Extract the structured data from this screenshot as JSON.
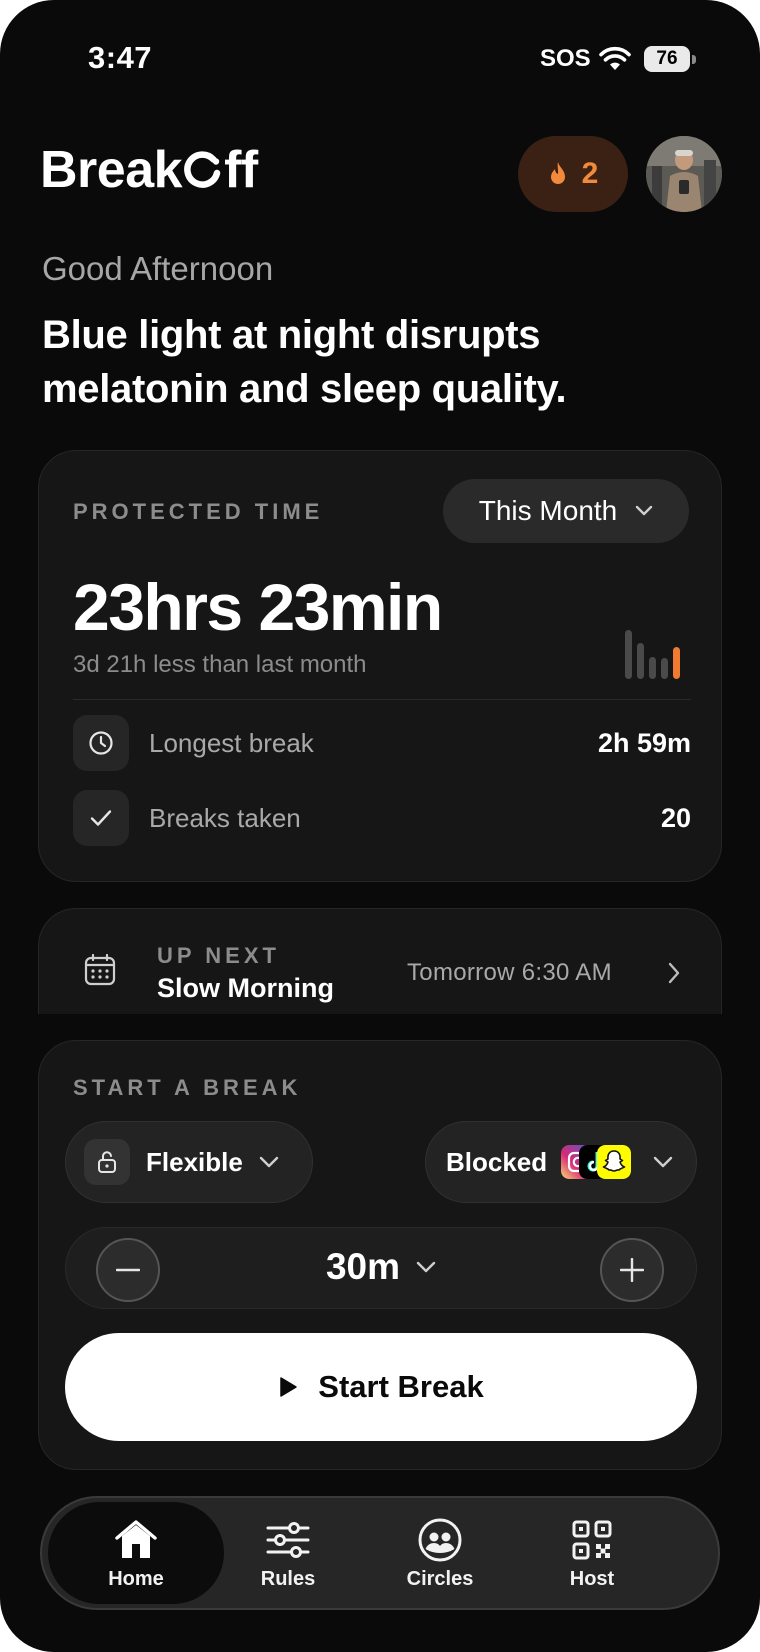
{
  "status_bar": {
    "time": "3:47",
    "carrier": "SOS",
    "battery": "76"
  },
  "header": {
    "logo_prefix": "Break",
    "logo_suffix": "ff",
    "streak_count": "2"
  },
  "greeting": "Good Afternoon",
  "tip": "Blue light at night disrupts melatonin and sleep quality.",
  "protected_time": {
    "label": "PROTECTED TIME",
    "period": "This Month",
    "total": "23hrs 23min",
    "comparison": "3d 21h less than last month",
    "mini_chart": {
      "values": [
        0.85,
        0.62,
        0.38,
        0.36,
        0.55
      ],
      "colors": [
        "#4a4a4a",
        "#4a4a4a",
        "#4a4a4a",
        "#4a4a4a",
        "#f07a32"
      ]
    },
    "stats": [
      {
        "label": "Longest break",
        "value": "2h 59m",
        "icon": "clock-icon"
      },
      {
        "label": "Breaks taken",
        "value": "20",
        "icon": "check-icon"
      }
    ]
  },
  "up_next": {
    "label": "UP NEXT",
    "title": "Slow Morning",
    "when": "Tomorrow 6:30 AM"
  },
  "start_break": {
    "label": "START A BREAK",
    "mode": "Flexible",
    "blocked_label": "Blocked",
    "duration": "30m",
    "button": "Start Break"
  },
  "tabs": [
    {
      "label": "Home",
      "icon": "home-icon",
      "active": true
    },
    {
      "label": "Rules",
      "icon": "sliders-icon",
      "active": false
    },
    {
      "label": "Circles",
      "icon": "people-circle-icon",
      "active": false
    },
    {
      "label": "Host",
      "icon": "qr-code-icon",
      "active": false
    }
  ],
  "colors": {
    "accent": "#f28a3c",
    "background": "#0a0a0a",
    "card": "#161616"
  }
}
